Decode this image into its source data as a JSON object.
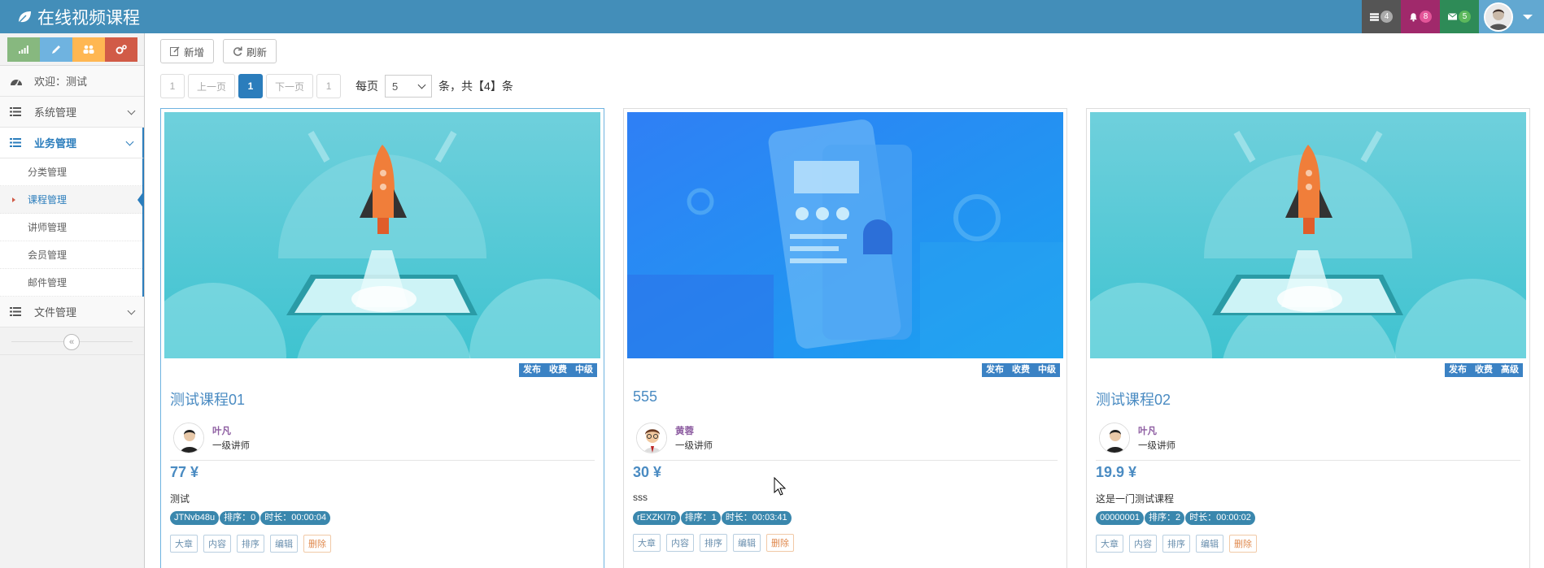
{
  "app": {
    "title": "在线视频课程"
  },
  "topnav": {
    "tasks_count": "4",
    "notifications_count": "8",
    "messages_count": "5"
  },
  "sidebar": {
    "welcome": "欢迎：测试",
    "menu": [
      {
        "label": "系统管理"
      },
      {
        "label": "业务管理"
      },
      {
        "label": "文件管理"
      }
    ],
    "submenu": [
      {
        "label": "分类管理"
      },
      {
        "label": "课程管理"
      },
      {
        "label": "讲师管理"
      },
      {
        "label": "会员管理"
      },
      {
        "label": "邮件管理"
      }
    ],
    "collapse_glyph": "«"
  },
  "toolbar": {
    "add_label": "新增",
    "refresh_label": "刷新"
  },
  "pager": {
    "first": "1",
    "prev": "上一页",
    "current": "1",
    "next": "下一页",
    "last": "1",
    "per_page_label": "每页",
    "per_page_value": "5",
    "total_text": "条，共【4】条"
  },
  "courses": [
    {
      "tags": [
        "发布",
        "收费",
        "中级"
      ],
      "title": "测试课程01",
      "teacher_name": "叶凡",
      "teacher_level": "一级讲师",
      "price": "77 ¥",
      "summary": "测试",
      "meta": [
        "JTNvb48u",
        "排序：0",
        "时长：00:00:04"
      ],
      "actions": [
        "大章",
        "内容",
        "排序",
        "编辑",
        "删除"
      ]
    },
    {
      "tags": [
        "发布",
        "收费",
        "中级"
      ],
      "title": "555",
      "teacher_name": "黄蓉",
      "teacher_level": "一级讲师",
      "price": "30 ¥",
      "summary": "sss",
      "meta": [
        "rEXZKI7p",
        "排序：1",
        "时长：00:03:41"
      ],
      "actions": [
        "大章",
        "内容",
        "排序",
        "编辑",
        "删除"
      ]
    },
    {
      "tags": [
        "发布",
        "收费",
        "高级"
      ],
      "title": "测试课程02",
      "teacher_name": "叶凡",
      "teacher_level": "一级讲师",
      "price": "19.9 ¥",
      "summary": "这是一门测试课程",
      "meta": [
        "00000001",
        "排序：2",
        "时长：00:00:02"
      ],
      "actions": [
        "大章",
        "内容",
        "排序",
        "编辑",
        "删除"
      ]
    }
  ],
  "colors": {
    "navbar": "#438eb9",
    "accent": "#2b7dbc",
    "link": "#4a8bc2"
  }
}
